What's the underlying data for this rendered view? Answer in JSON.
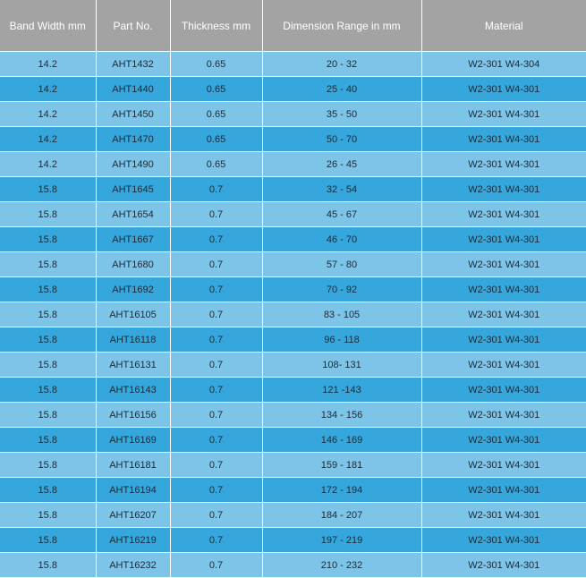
{
  "table": {
    "headers": [
      "Band Width  mm",
      "Part No.",
      "Thickness  mm",
      "Dimension Range in mm",
      "Material"
    ],
    "rows": [
      [
        "14.2",
        "AHT1432",
        "0.65",
        "20 - 32",
        "W2-301 W4-304"
      ],
      [
        "14.2",
        "AHT1440",
        "0.65",
        "25 - 40",
        "W2-301 W4-301"
      ],
      [
        "14.2",
        "AHT1450",
        "0.65",
        "35 - 50",
        "W2-301 W4-301"
      ],
      [
        "14.2",
        "AHT1470",
        "0.65",
        "50 - 70",
        "W2-301 W4-301"
      ],
      [
        "14.2",
        "AHT1490",
        "0.65",
        "26 - 45",
        "W2-301 W4-301"
      ],
      [
        "15.8",
        "AHT1645",
        "0.7",
        "32 - 54",
        "W2-301 W4-301"
      ],
      [
        "15.8",
        "AHT1654",
        "0.7",
        "45 - 67",
        "W2-301 W4-301"
      ],
      [
        "15.8",
        "AHT1667",
        "0.7",
        "46 - 70",
        "W2-301 W4-301"
      ],
      [
        "15.8",
        "AHT1680",
        "0.7",
        "57 - 80",
        "W2-301 W4-301"
      ],
      [
        "15.8",
        "AHT1692",
        "0.7",
        "70 - 92",
        "W2-301 W4-301"
      ],
      [
        "15.8",
        "AHT16105",
        "0.7",
        "83 - 105",
        "W2-301 W4-301"
      ],
      [
        "15.8",
        "AHT16118",
        "0.7",
        "96 - 118",
        "W2-301 W4-301"
      ],
      [
        "15.8",
        "AHT16131",
        "0.7",
        "108- 131",
        "W2-301 W4-301"
      ],
      [
        "15.8",
        "AHT16143",
        "0.7",
        "121 -143",
        "W2-301 W4-301"
      ],
      [
        "15.8",
        "AHT16156",
        "0.7",
        "134 - 156",
        "W2-301 W4-301"
      ],
      [
        "15.8",
        "AHT16169",
        "0.7",
        "146 - 169",
        "W2-301 W4-301"
      ],
      [
        "15.8",
        "AHT16181",
        "0.7",
        "159 - 181",
        "W2-301 W4-301"
      ],
      [
        "15.8",
        "AHT16194",
        "0.7",
        "172 - 194",
        "W2-301 W4-301"
      ],
      [
        "15.8",
        "AHT16207",
        "0.7",
        "184 - 207",
        "W2-301 W4-301"
      ],
      [
        "15.8",
        "AHT16219",
        "0.7",
        "197 - 219",
        "W2-301 W4-301"
      ],
      [
        "15.8",
        "AHT16232",
        "0.7",
        "210 - 232",
        "W2-301 W4-301"
      ]
    ]
  },
  "colors": {
    "header_bg": "#a3a3a3",
    "row_light": "#7cc4e8",
    "row_dark": "#35a7dd"
  }
}
